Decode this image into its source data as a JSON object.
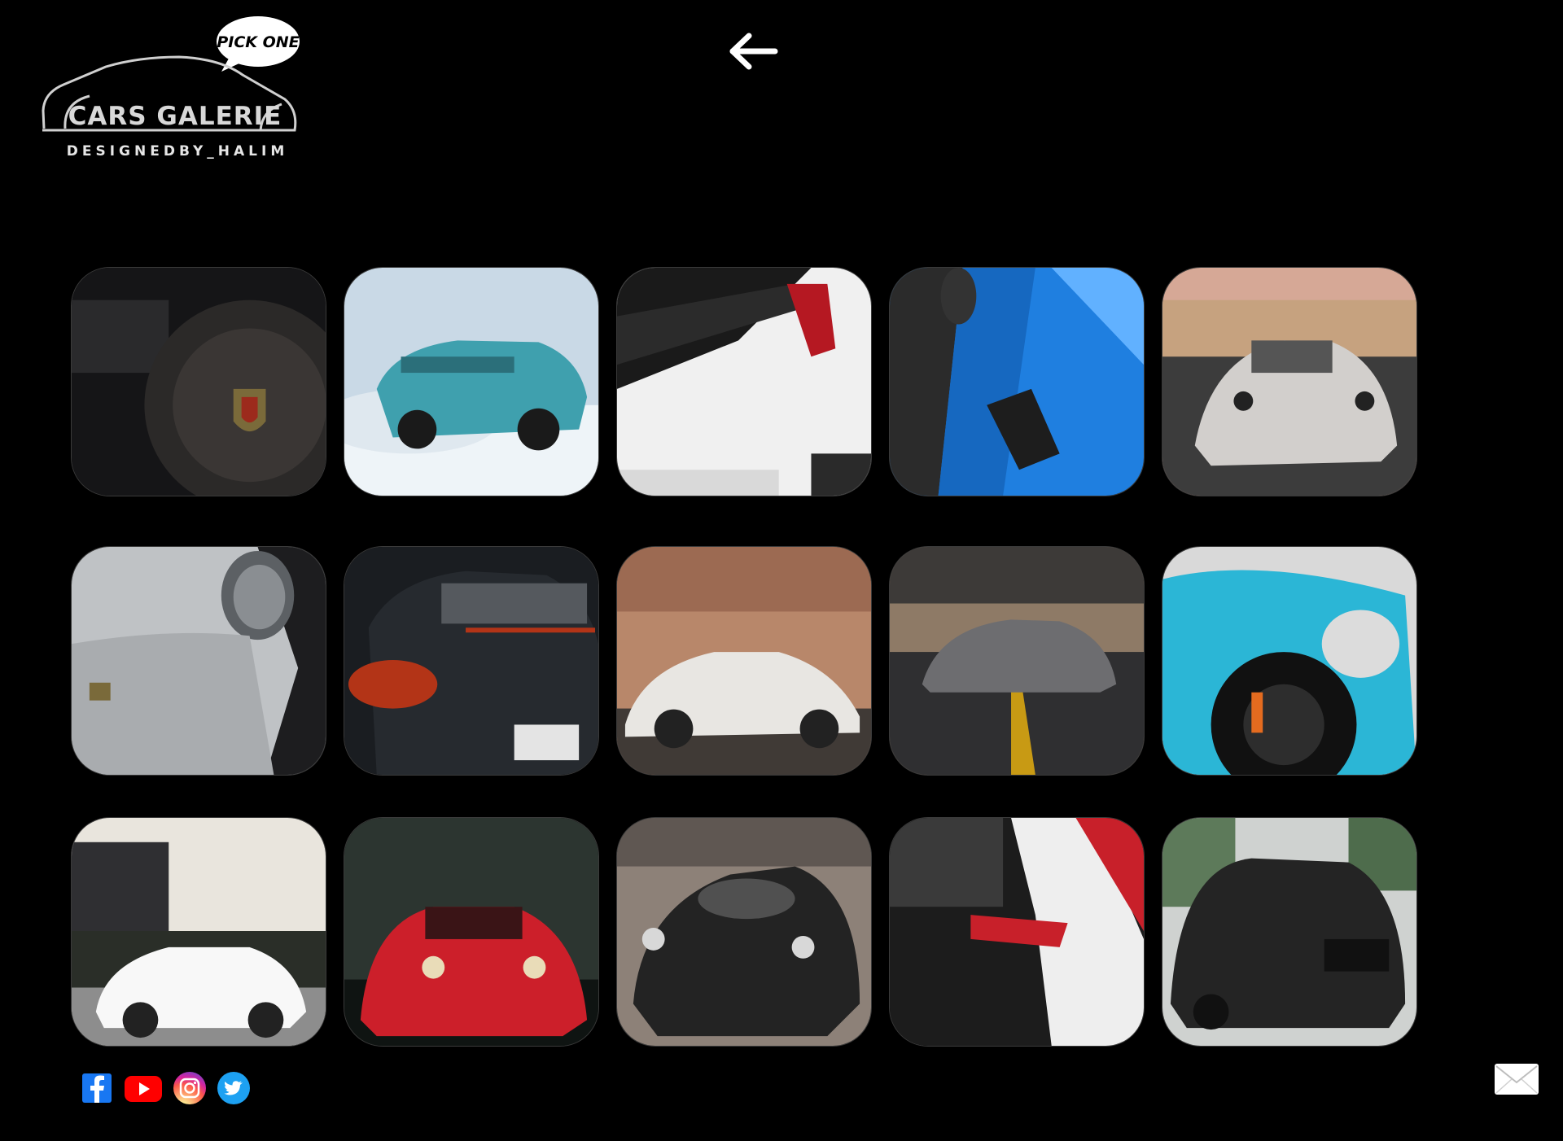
{
  "logo": {
    "bubble_text": "PICK ONE",
    "name": "CARS GALERIE",
    "tagline": "DESIGNEDBY_HALIM"
  },
  "nav": {
    "back_icon": "arrow-left-icon"
  },
  "gallery": {
    "photos": [
      {
        "subject": "steering-wheel-crest",
        "palette": [
          "#1b1b1d",
          "#3a3634",
          "#7a6a3a"
        ]
      },
      {
        "subject": "teal-911-snow-drift",
        "palette": [
          "#c9d9e6",
          "#3fa0ae",
          "#eef4f8"
        ]
      },
      {
        "subject": "white-carrera-s-rear",
        "palette": [
          "#f0f0f0",
          "#1a1a1a",
          "#b51822"
        ]
      },
      {
        "subject": "blue-hood-vent",
        "palette": [
          "#1f7fe0",
          "#2b2b2b",
          "#61b1ff"
        ]
      },
      {
        "subject": "grey-gt3rs-road",
        "palette": [
          "#c6a27f",
          "#d2cfcc",
          "#3c3c3c"
        ]
      },
      {
        "subject": "silver-front-fender",
        "palette": [
          "#bfc2c5",
          "#5c6064",
          "#1d1d1f"
        ]
      },
      {
        "subject": "black-911-rain-rear",
        "palette": [
          "#262a2f",
          "#b33417",
          "#55595e"
        ]
      },
      {
        "subject": "classic-911-sunset",
        "palette": [
          "#b8876a",
          "#e8e6e2",
          "#403a36"
        ]
      },
      {
        "subject": "grey-gt3-highway",
        "palette": [
          "#8e7a66",
          "#6d6d70",
          "#2f2f31"
        ]
      },
      {
        "subject": "blue-gt3rs-wheel",
        "palette": [
          "#2bb6d6",
          "#d9d9d9",
          "#111111"
        ]
      },
      {
        "subject": "white-918-spyder",
        "palette": [
          "#e9e5dd",
          "#f8f8f8",
          "#2a2e28"
        ]
      },
      {
        "subject": "red-911-forest",
        "palette": [
          "#2c3530",
          "#cc1f2a",
          "#0f1412"
        ]
      },
      {
        "subject": "matte-black-918",
        "palette": [
          "#8d8178",
          "#232323",
          "#505050"
        ]
      },
      {
        "subject": "carbon-white-rear",
        "palette": [
          "#1c1c1c",
          "#eeeeee",
          "#c8202a"
        ]
      },
      {
        "subject": "matte-black-cayenne",
        "palette": [
          "#cfd2d0",
          "#242424",
          "#5d7a5a"
        ]
      }
    ]
  },
  "social": [
    {
      "name": "facebook-icon",
      "color": "#1877f2"
    },
    {
      "name": "youtube-icon",
      "color": "#ff0000"
    },
    {
      "name": "instagram-icon",
      "color": "#d6249f"
    },
    {
      "name": "twitter-icon",
      "color": "#1da1f2"
    }
  ],
  "contact": {
    "icon": "envelope-icon"
  }
}
